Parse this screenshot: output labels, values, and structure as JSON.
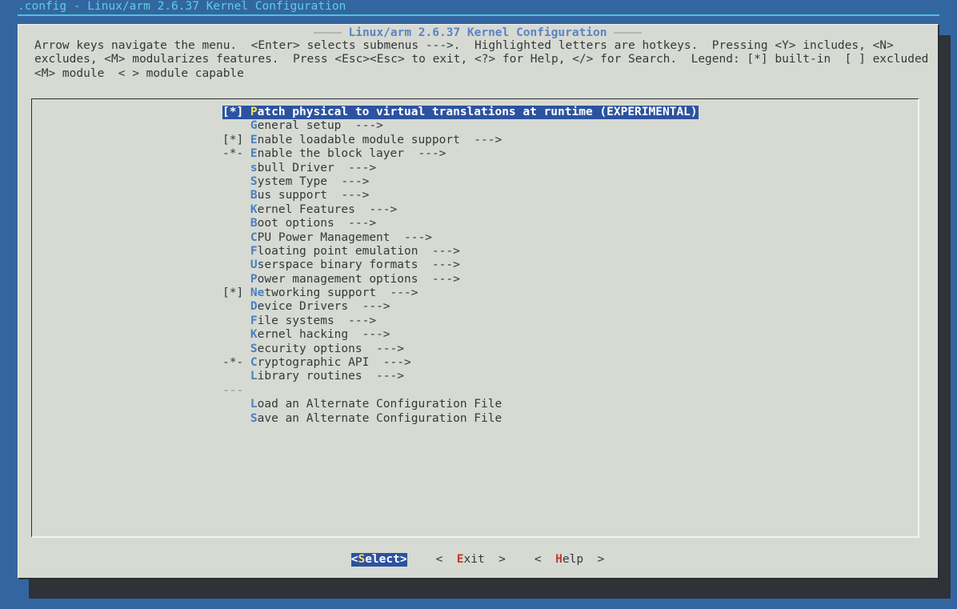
{
  "window": {
    "title": ".config - Linux/arm 2.6.37 Kernel Configuration",
    "bg_color": "#3366a0",
    "title_color": "#5ecfe0"
  },
  "dialog": {
    "title": "Linux/arm 2.6.37 Kernel Configuration",
    "title_dash_left": "———— ",
    "title_dash_right": " ————",
    "bg_color": "#d6dad2",
    "help_text": "Arrow keys navigate the menu.  <Enter> selects submenus --->.  Highlighted letters are hotkeys.  Pressing <Y> includes, <N> excludes, <M> modularizes features.  Press <Esc><Esc> to exit, <?> for Help, </> for Search.  Legend: [*] built-in  [ ] excluded  <M> module  < > module capable"
  },
  "menu": {
    "selected_index": 0,
    "items": [
      {
        "flag": "[*] ",
        "hotkey": "P",
        "label": "atch physical to virtual translations at runtime (EXPERIMENTAL)",
        "arrow": ""
      },
      {
        "flag": "    ",
        "hotkey": "G",
        "label": "eneral setup",
        "arrow": "  --->"
      },
      {
        "flag": "[*] ",
        "hotkey": "E",
        "label": "nable loadable module support",
        "arrow": "  --->"
      },
      {
        "flag": "-*- ",
        "hotkey": "E",
        "label": "nable the block layer",
        "arrow": "  --->"
      },
      {
        "flag": "    ",
        "hotkey": "s",
        "label": "bull Driver",
        "arrow": "  --->"
      },
      {
        "flag": "    ",
        "hotkey": "S",
        "label": "ystem Type",
        "arrow": "  --->"
      },
      {
        "flag": "    ",
        "hotkey": "B",
        "label": "us support",
        "arrow": "  --->"
      },
      {
        "flag": "    ",
        "hotkey": "K",
        "label": "ernel Features",
        "arrow": "  --->"
      },
      {
        "flag": "    ",
        "hotkey": "B",
        "label": "oot options",
        "arrow": "  --->"
      },
      {
        "flag": "    ",
        "hotkey": "C",
        "label": "PU Power Management",
        "arrow": "  --->"
      },
      {
        "flag": "    ",
        "hotkey": "F",
        "label": "loating point emulation",
        "arrow": "  --->"
      },
      {
        "flag": "    ",
        "hotkey": "U",
        "label": "serspace binary formats",
        "arrow": "  --->"
      },
      {
        "flag": "    ",
        "hotkey": "P",
        "label": "ower management options",
        "arrow": "  --->"
      },
      {
        "flag": "[*] ",
        "hotkey": "Ne",
        "label": "tworking support",
        "arrow": "  --->"
      },
      {
        "flag": "    ",
        "hotkey": "D",
        "label": "evice Drivers",
        "arrow": "  --->"
      },
      {
        "flag": "    ",
        "hotkey": "F",
        "label": "ile systems",
        "arrow": "  --->"
      },
      {
        "flag": "    ",
        "hotkey": "K",
        "label": "ernel hacking",
        "arrow": "  --->"
      },
      {
        "flag": "    ",
        "hotkey": "S",
        "label": "ecurity options",
        "arrow": "  --->"
      },
      {
        "flag": "-*- ",
        "hotkey": "C",
        "label": "ryptographic API",
        "arrow": "  --->"
      },
      {
        "flag": "    ",
        "hotkey": "L",
        "label": "ibrary routines",
        "arrow": "  --->"
      },
      {
        "separator": "---"
      },
      {
        "flag": "    ",
        "hotkey": "L",
        "label": "oad an Alternate Configuration File",
        "arrow": ""
      },
      {
        "flag": "    ",
        "hotkey": "S",
        "label": "ave an Alternate Configuration File",
        "arrow": ""
      }
    ]
  },
  "buttons": {
    "active_index": 0,
    "items": [
      {
        "prefix": "<",
        "key": "S",
        "rest": "elect>",
        "active": true
      },
      {
        "prefix": "<  ",
        "key": "E",
        "rest": "xit  >",
        "active": false
      },
      {
        "prefix": "<  ",
        "key": "H",
        "rest": "elp  >",
        "active": false
      }
    ]
  },
  "colors": {
    "terminal_bg": "#3366a0",
    "panel_bg": "#d6dad2",
    "hotkey_blue": "#4a7fc0",
    "hotkey_yellow": "#f2e34a",
    "hotkey_red": "#c0392b",
    "selection_bg": "#2c52a0",
    "title_cyan": "#5ecfe0",
    "dialog_title_blue": "#5b83c4",
    "text": "#34383a",
    "shadow": "#2f3237"
  }
}
